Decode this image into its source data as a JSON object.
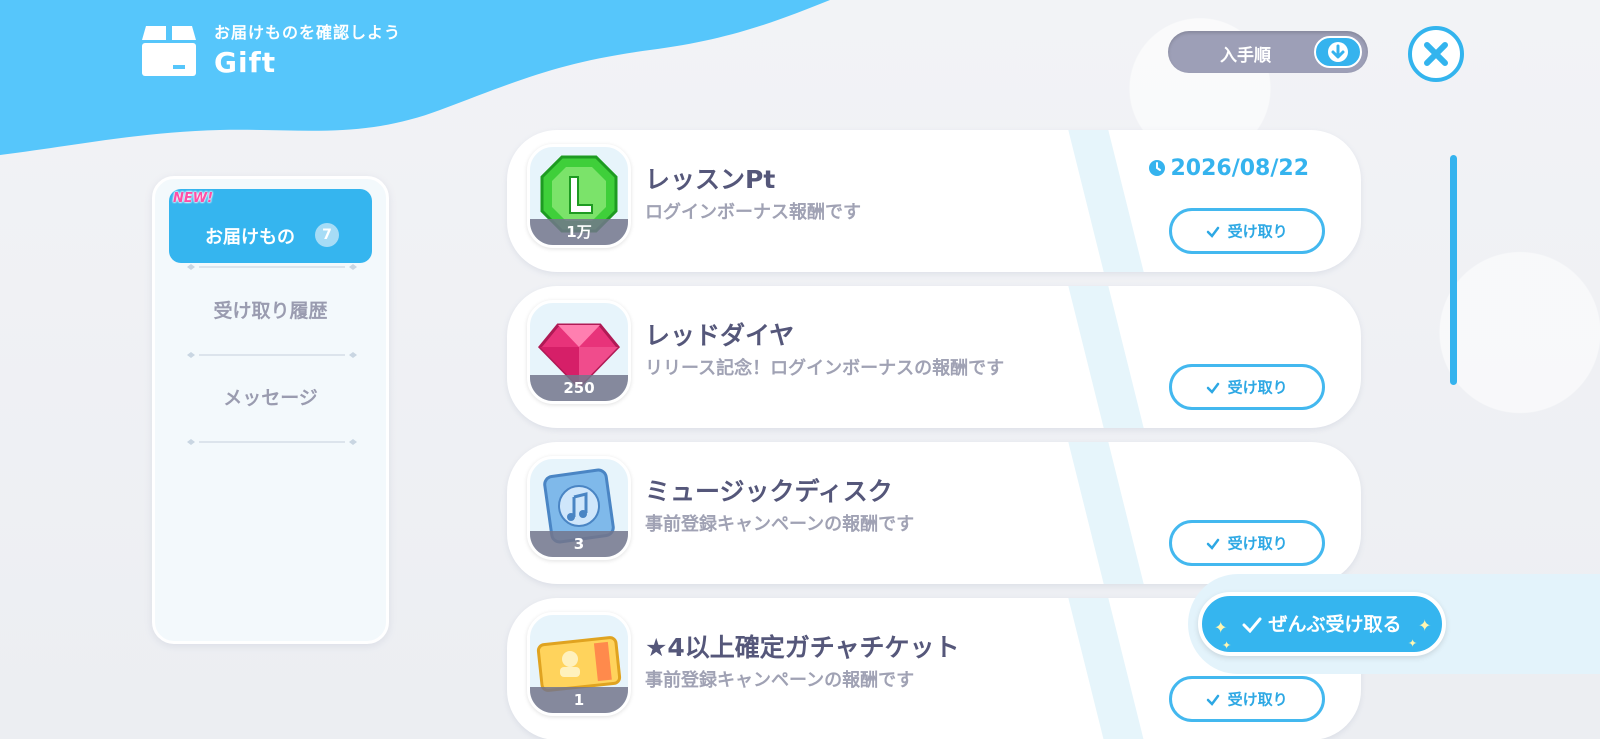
{
  "header": {
    "subtitle": "お届けものを確認しよう",
    "title": "Gift"
  },
  "sort": {
    "label": "入手順",
    "direction_icon": "arrow-down-icon"
  },
  "close_icon": "close-icon",
  "sidebar": {
    "new_badge": "NEW!",
    "items": [
      {
        "label": "お届けもの",
        "count": "7",
        "active": true
      },
      {
        "label": "受け取り履歴",
        "active": false
      },
      {
        "label": "メッセージ",
        "active": false
      }
    ]
  },
  "gifts": [
    {
      "name": "レッスンPt",
      "desc": "ログインボーナス報酬です",
      "qty": "1万",
      "date": "2026/08/22",
      "icon": "lesson-pt-icon",
      "claim_label": "受け取り"
    },
    {
      "name": "レッドダイヤ",
      "desc": "リリース記念！ログインボーナスの報酬です",
      "qty": "250",
      "date": "",
      "icon": "red-diamond-icon",
      "claim_label": "受け取り"
    },
    {
      "name": "ミュージックディスク",
      "desc": "事前登録キャンペーンの報酬です",
      "qty": "3",
      "date": "",
      "icon": "music-disc-icon",
      "claim_label": "受け取り"
    },
    {
      "name": "★4以上確定ガチャチケット",
      "desc": "事前登録キャンペーンの報酬です",
      "qty": "1",
      "date": "",
      "icon": "gacha-ticket-icon",
      "claim_label": "受け取り"
    }
  ],
  "claim_all": {
    "label": "ぜんぶ受け取る"
  },
  "colors": {
    "accent": "#35b5ef",
    "text_dark": "#55577a",
    "text_muted": "#a0a2b4",
    "sort_pill": "#9d9fb7"
  }
}
